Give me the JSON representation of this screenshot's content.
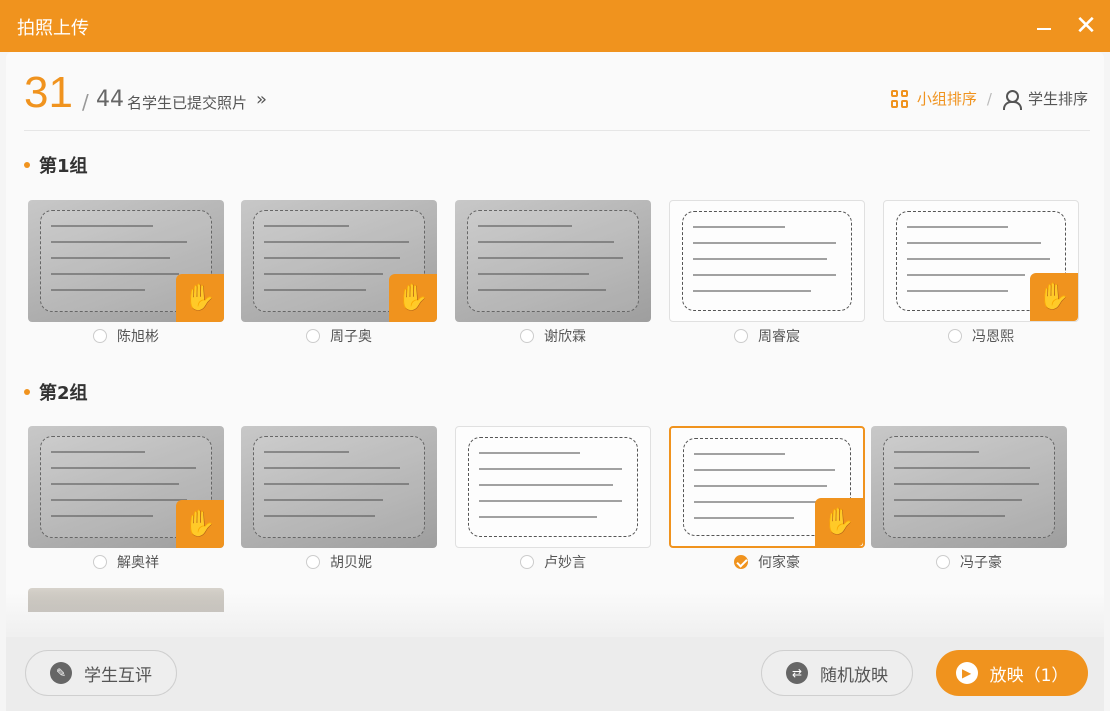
{
  "window": {
    "title": "拍照上传"
  },
  "header": {
    "submitted": "31",
    "separator": "/",
    "total": "44",
    "label": "名学生已提交照片",
    "arrow": "»",
    "sort_group": "小组排序",
    "sort_sep": "/",
    "sort_student": "学生排序"
  },
  "groups": [
    {
      "title": "第1组",
      "students": [
        {
          "name": "陈旭彬",
          "raised_hand": true,
          "selected": false
        },
        {
          "name": "周子奥",
          "raised_hand": true,
          "selected": false
        },
        {
          "name": "谢欣霖",
          "raised_hand": false,
          "selected": false
        },
        {
          "name": "周睿宸",
          "raised_hand": false,
          "selected": false
        },
        {
          "name": "冯恩熙",
          "raised_hand": true,
          "selected": false
        }
      ]
    },
    {
      "title": "第2组",
      "students": [
        {
          "name": "解奥祥",
          "raised_hand": true,
          "selected": false
        },
        {
          "name": "胡贝妮",
          "raised_hand": false,
          "selected": false
        },
        {
          "name": "卢妙言",
          "raised_hand": false,
          "selected": false
        },
        {
          "name": "何家豪",
          "raised_hand": true,
          "selected": true
        },
        {
          "name": "冯子豪",
          "raised_hand": false,
          "selected": false
        }
      ]
    }
  ],
  "footer": {
    "peer_review": "学生互评",
    "random_play": "随机放映",
    "play": "放映（1）"
  },
  "colors": {
    "accent": "#f0931e"
  },
  "icons": {
    "hand": "raised-hand-icon",
    "grid": "grid-icon",
    "user": "user-icon",
    "edit": "edit-icon",
    "shuffle": "shuffle-icon",
    "play": "play-icon"
  }
}
